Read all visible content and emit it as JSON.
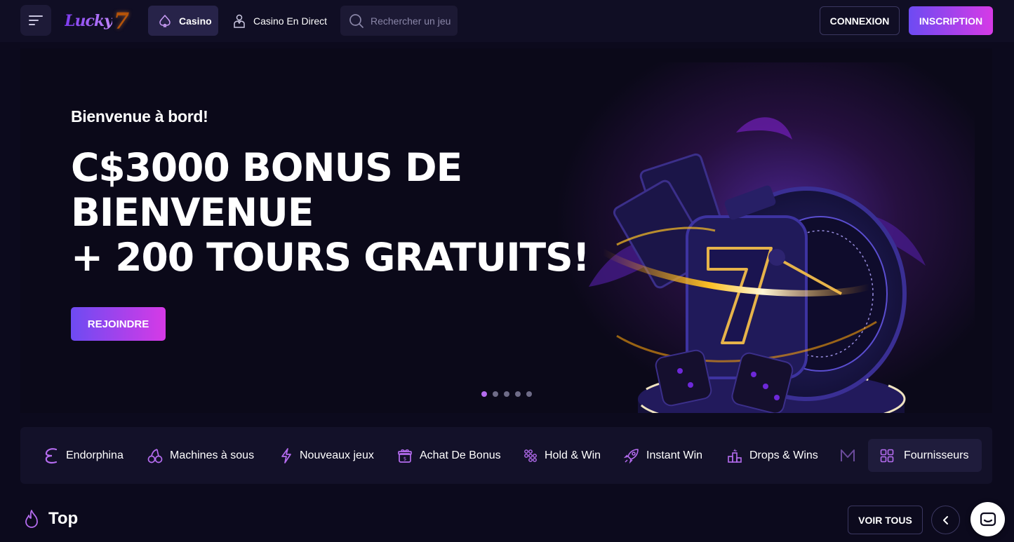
{
  "header": {
    "logo_text": "Lucky",
    "logo_number": "7",
    "nav": {
      "casino": "Casino",
      "live": "Casino En Direct"
    },
    "search_placeholder": "Rechercher un jeu",
    "login": "CONNEXION",
    "register": "INSCRIPTION"
  },
  "hero": {
    "welcome": "Bienvenue à bord!",
    "headline": [
      "C$3000 BONUS DE",
      "BIENVENUE",
      "+ 200 TOURS GRATUITS!"
    ],
    "cta": "REJOINDRE",
    "slide_count": 5,
    "active_slide": 1
  },
  "categories": [
    {
      "label": "Endorphina",
      "icon": "endorphina-icon"
    },
    {
      "label": "Machines à sous",
      "icon": "cherries-icon"
    },
    {
      "label": "Nouveaux jeux",
      "icon": "lightning-icon"
    },
    {
      "label": "Achat De Bonus",
      "icon": "gift-icon"
    },
    {
      "label": "Hold & Win",
      "icon": "grid-dots-icon"
    },
    {
      "label": "Instant Win",
      "icon": "rocket-icon"
    },
    {
      "label": "Drops & Wins",
      "icon": "podium-icon"
    }
  ],
  "providers_label": "Fournisseurs",
  "top_section": {
    "title": "Top",
    "see_all": "VOIR TOUS"
  },
  "colors": {
    "background": "#0c0a1d",
    "accent_gradient_start": "#6d4bf2",
    "accent_gradient_end": "#d63ae6",
    "icon_purple": "#b56cf0"
  }
}
